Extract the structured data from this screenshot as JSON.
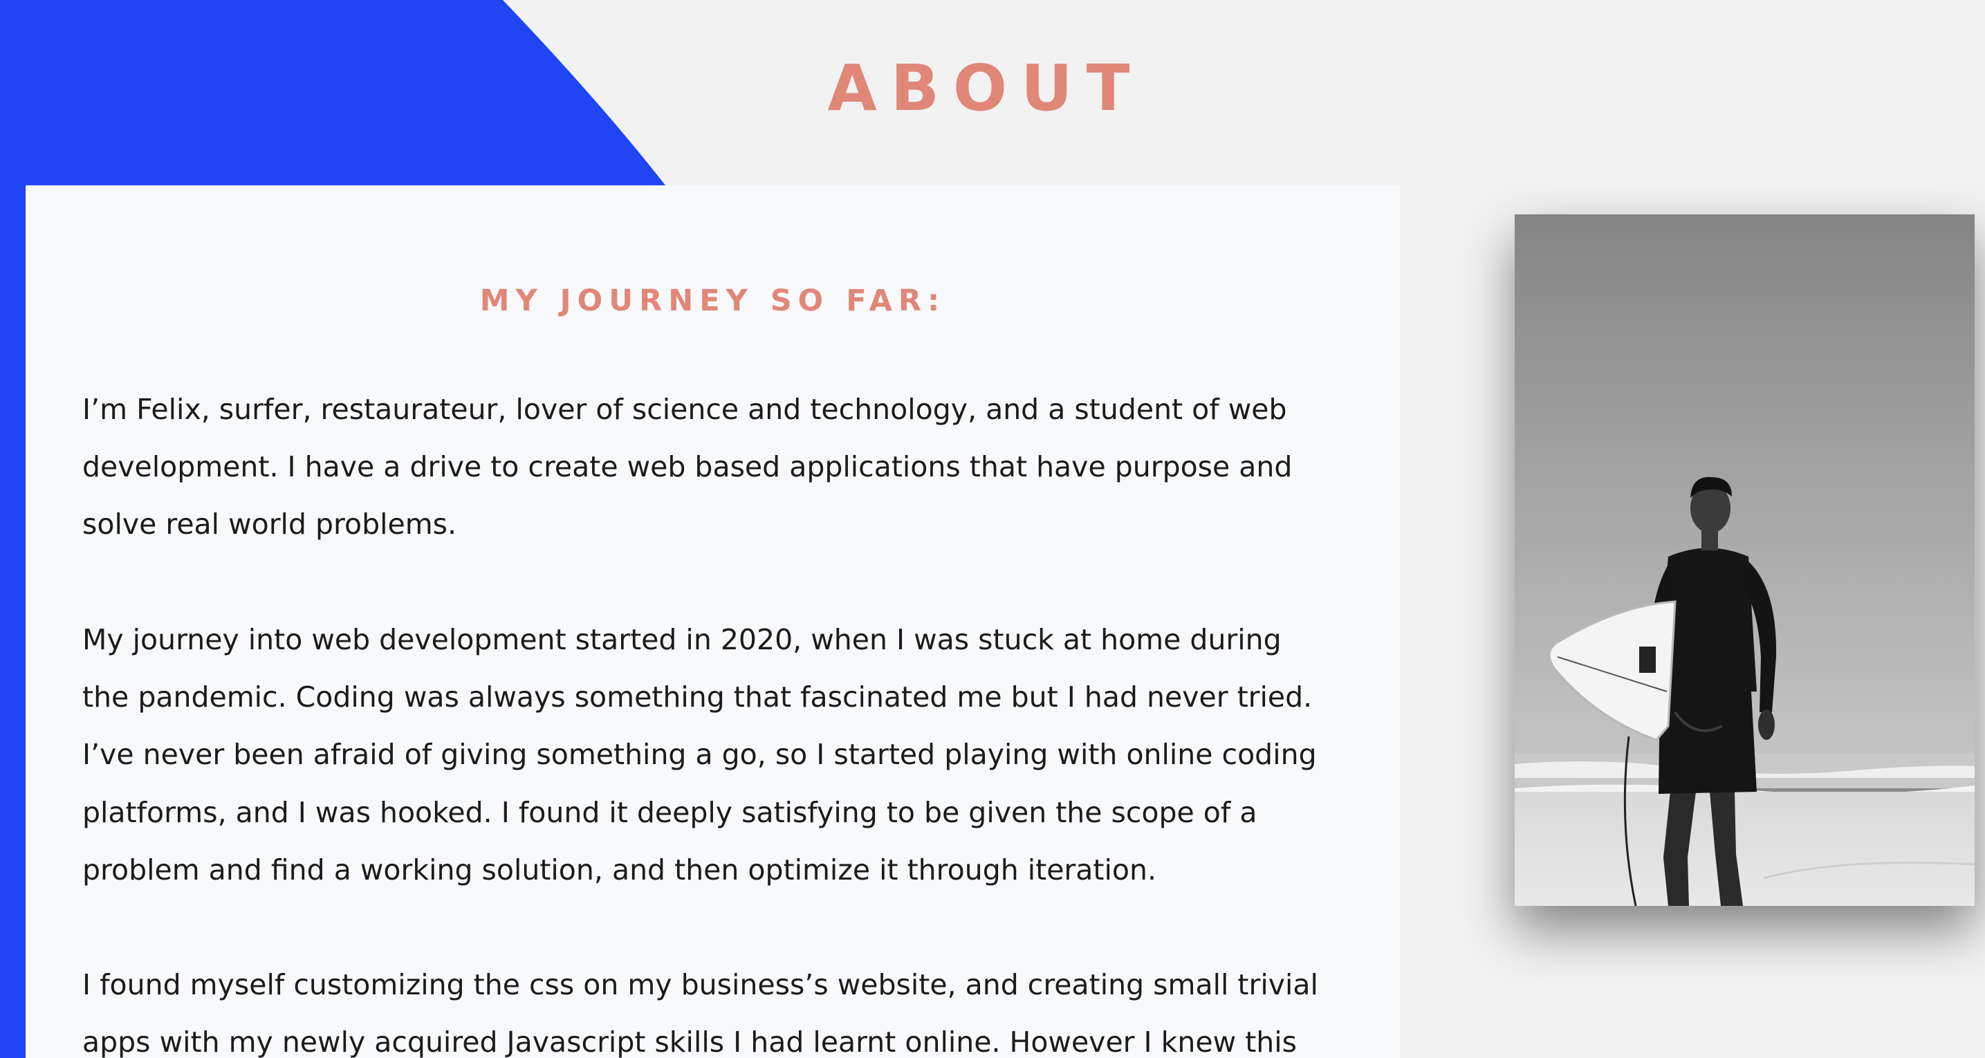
{
  "colors": {
    "accent_blue": "#1f45f5",
    "heading_coral": "#e08778",
    "page_background": "#f2f2f2",
    "card_background": "#f8f9fb",
    "body_text": "#1b1b1b"
  },
  "header": {
    "title": "ABOUT"
  },
  "about_card": {
    "heading": "MY JOURNEY SO FAR:",
    "paragraph_1": [
      "I’m Felix, surfer, restaurateur, lover of science and technology, and a student of web",
      "development. I have a drive to create web based applications that have purpose and",
      "solve real world problems."
    ],
    "paragraph_2": [
      "My journey into web development started in 2020, when I was stuck at home during",
      "the pandemic. Coding was always something that fascinated me but I had never tried.",
      "I’ve never been afraid of giving something a go, so I started playing with online coding",
      "platforms, and I was hooked. I found it deeply satisfying to be given the scope of a",
      "problem and find a working solution, and then optimize it through iteration."
    ],
    "paragraph_3": [
      "I found myself customizing the css on my business’s website, and creating small trivial",
      "apps with my newly acquired Javascript skills I had learnt online. However I knew this"
    ]
  },
  "photo": {
    "subject": "black-and-white photo of a surfer in a wetsuit holding a surfboard on a beach"
  }
}
